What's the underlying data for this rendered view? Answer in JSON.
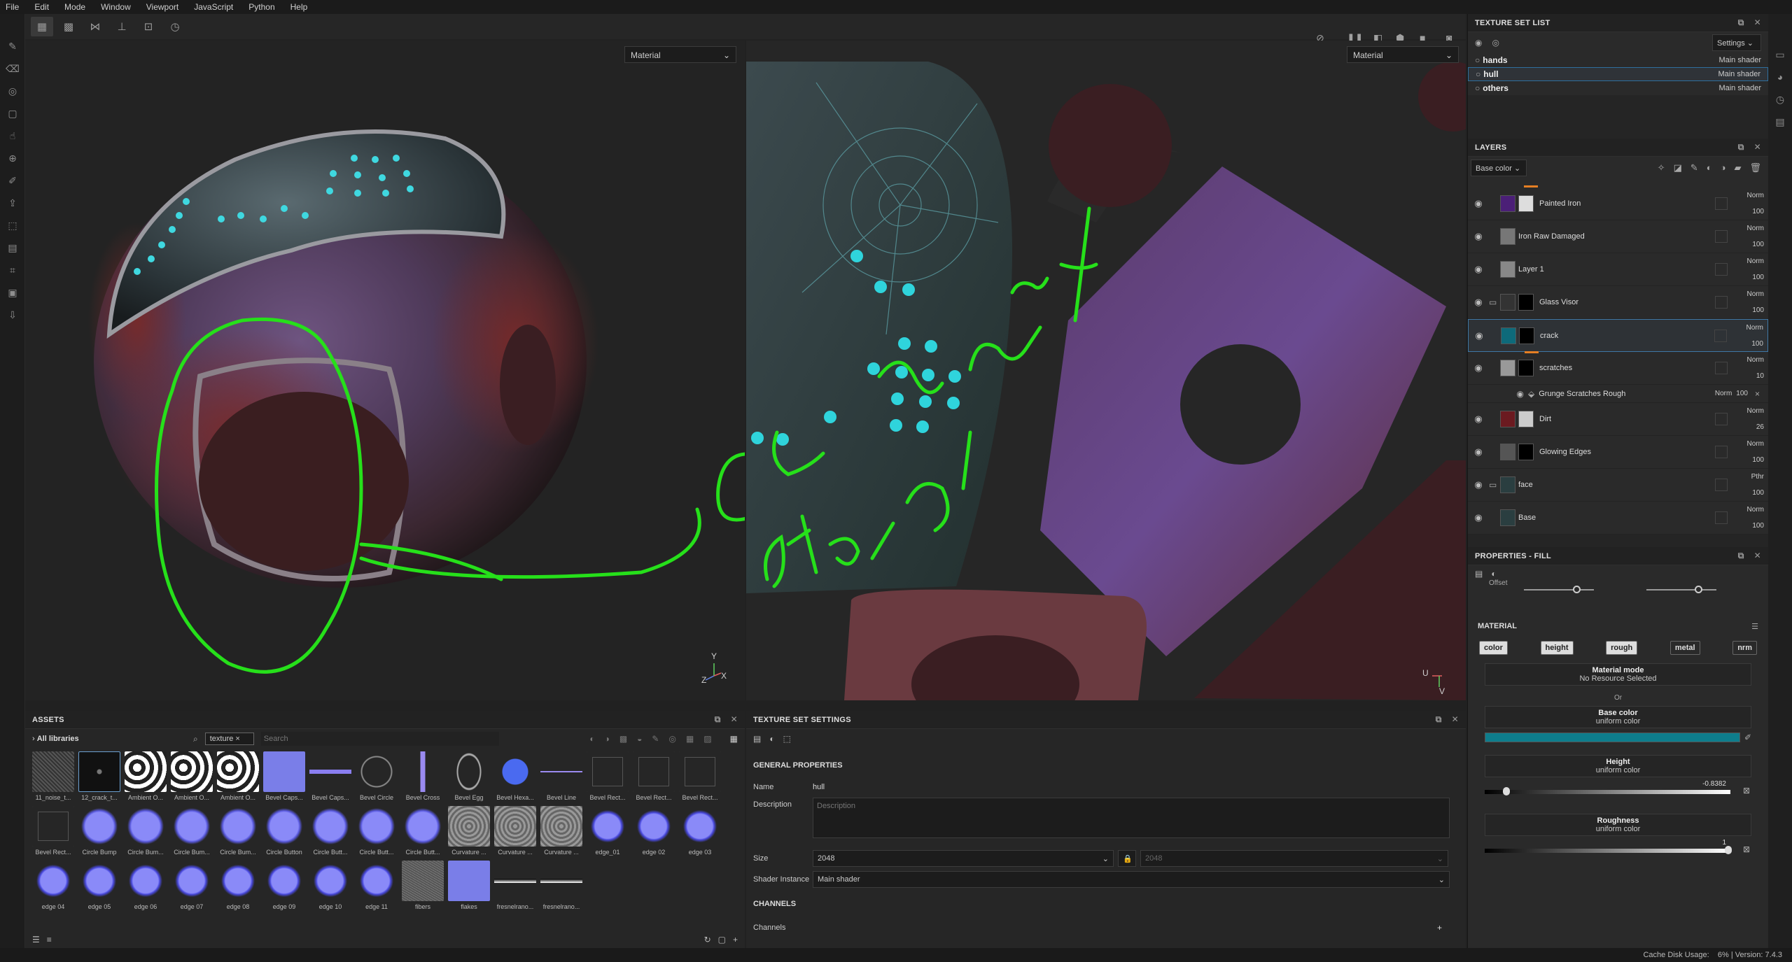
{
  "menu": [
    "File",
    "Edit",
    "Mode",
    "Window",
    "Viewport",
    "JavaScript",
    "Python",
    "Help"
  ],
  "viewport3d": {
    "mode_select": "Material",
    "gizmo": "Y Z X",
    "annotation": "Gonna add detail here"
  },
  "viewport2d": {
    "mode_select": "Material",
    "gizmo": "U V"
  },
  "texture_set_list": {
    "title": "TEXTURE SET LIST",
    "settings": "Settings",
    "sets": [
      {
        "name": "hands",
        "shader": "Main shader"
      },
      {
        "name": "hull",
        "shader": "Main shader"
      },
      {
        "name": "others",
        "shader": "Main shader"
      }
    ]
  },
  "layers": {
    "title": "LAYERS",
    "channel": "Base color",
    "items": [
      {
        "name": "Painted Iron",
        "blend": "Norm",
        "opacity": "100",
        "color": "#4b1f77"
      },
      {
        "name": "Iron Raw Damaged",
        "blend": "Norm",
        "opacity": "100",
        "color": "#777"
      },
      {
        "name": "Layer 1",
        "blend": "Norm",
        "opacity": "100",
        "color": "#888"
      },
      {
        "name": "Glass Visor",
        "blend": "Norm",
        "opacity": "100",
        "color": "#333"
      },
      {
        "name": "crack",
        "blend": "Norm",
        "opacity": "100",
        "color": "#0e6a7a"
      },
      {
        "name": "scratches",
        "blend": "Norm",
        "opacity": "10",
        "color": "#999"
      },
      {
        "name": "Dirt",
        "blend": "Norm",
        "opacity": "26",
        "color": "#6b1a20"
      },
      {
        "name": "Glowing Edges",
        "blend": "Norm",
        "opacity": "100",
        "color": "#555"
      },
      {
        "name": "face",
        "blend": "Pthr",
        "opacity": "100",
        "color": "#2a3e40"
      },
      {
        "name": "Base",
        "blend": "Norm",
        "opacity": "100",
        "color": "#2a3e40"
      }
    ],
    "effect": {
      "name": "Grunge Scratches Rough",
      "blend": "Norm",
      "opacity": "100"
    }
  },
  "properties": {
    "title": "PROPERTIES - FILL",
    "offset_label": "Offset",
    "material_title": "MATERIAL",
    "channels": [
      "color",
      "height",
      "rough",
      "metal",
      "nrm"
    ],
    "material_mode": {
      "label": "Material mode",
      "value": "No Resource Selected"
    },
    "or_text": "Or",
    "base_color": {
      "label": "Base color",
      "value": "uniform color",
      "swatch": "#0e7d8c"
    },
    "height": {
      "label": "Height",
      "value": "uniform color",
      "number": "-0.8382"
    },
    "roughness": {
      "label": "Roughness",
      "value": "uniform color",
      "number": "1"
    }
  },
  "assets": {
    "title": "ASSETS",
    "library": "All libraries",
    "filter_tag": "texture",
    "search_placeholder": "Search",
    "items": [
      {
        "name": "11_noise_t...",
        "kind": "noise"
      },
      {
        "name": "12_crack_t...",
        "kind": "crack"
      },
      {
        "name": "Ambient O...",
        "kind": "ao"
      },
      {
        "name": "Ambient O...",
        "kind": "ao"
      },
      {
        "name": "Ambient O...",
        "kind": "ao"
      },
      {
        "name": "Bevel Caps...",
        "kind": "nrm"
      },
      {
        "name": "Bevel Caps...",
        "kind": "dash"
      },
      {
        "name": "Bevel Circle",
        "kind": "circle"
      },
      {
        "name": "Bevel Cross",
        "kind": "cross"
      },
      {
        "name": "Bevel Egg",
        "kind": "egg"
      },
      {
        "name": "Bevel Hexa...",
        "kind": "hex"
      },
      {
        "name": "Bevel Line",
        "kind": "line"
      },
      {
        "name": "Bevel Rect...",
        "kind": "rect"
      },
      {
        "name": "Bevel Rect...",
        "kind": "rect"
      },
      {
        "name": "Bevel Rect...",
        "kind": "rect"
      },
      {
        "name": "Bevel Rect...",
        "kind": "rect"
      },
      {
        "name": "Circle Bump",
        "kind": "bump"
      },
      {
        "name": "Circle Bum...",
        "kind": "bump"
      },
      {
        "name": "Circle Bum...",
        "kind": "bump"
      },
      {
        "name": "Circle Bum...",
        "kind": "bump"
      },
      {
        "name": "Circle Button",
        "kind": "bump"
      },
      {
        "name": "Circle Butt...",
        "kind": "bump"
      },
      {
        "name": "Circle Butt...",
        "kind": "bump"
      },
      {
        "name": "Circle Butt...",
        "kind": "bump"
      },
      {
        "name": "Curvature ...",
        "kind": "curv"
      },
      {
        "name": "Curvature ...",
        "kind": "curv"
      },
      {
        "name": "Curvature ...",
        "kind": "curv"
      },
      {
        "name": "edge_01",
        "kind": "edge"
      },
      {
        "name": "edge 02",
        "kind": "edge"
      },
      {
        "name": "edge 03",
        "kind": "edge"
      },
      {
        "name": "edge 04",
        "kind": "edge"
      },
      {
        "name": "edge 05",
        "kind": "edge"
      },
      {
        "name": "edge 06",
        "kind": "edge"
      },
      {
        "name": "edge 07",
        "kind": "edge"
      },
      {
        "name": "edge 08",
        "kind": "edge"
      },
      {
        "name": "edge 09",
        "kind": "edge"
      },
      {
        "name": "edge 10",
        "kind": "edge"
      },
      {
        "name": "edge 11",
        "kind": "edge"
      },
      {
        "name": "fibers",
        "kind": "fibers"
      },
      {
        "name": "flakes",
        "kind": "nrm"
      },
      {
        "name": "fresnelrano...",
        "kind": "fres"
      },
      {
        "name": "fresnelrano...",
        "kind": "fres"
      }
    ]
  },
  "tss": {
    "title": "TEXTURE SET SETTINGS",
    "general": "GENERAL PROPERTIES",
    "name_label": "Name",
    "name_value": "hull",
    "desc_label": "Description",
    "desc_placeholder": "Description",
    "size_label": "Size",
    "size_value": "2048",
    "size_value2": "2048",
    "shader_label": "Shader Instance",
    "shader_value": "Main shader",
    "channels_title": "CHANNELS",
    "channels_label": "Channels"
  },
  "status": {
    "text": "Cache Disk Usage:    6% | Version: 7.4.3"
  }
}
